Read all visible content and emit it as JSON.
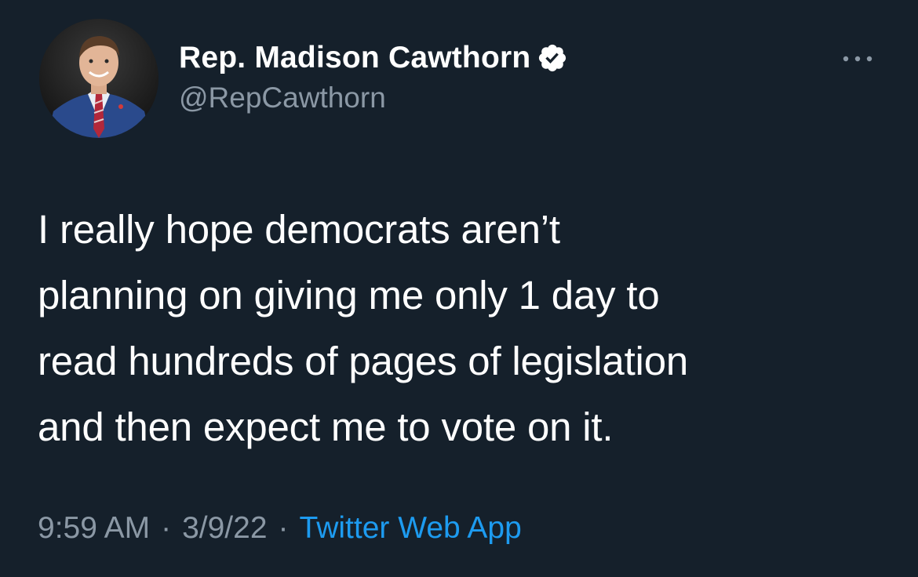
{
  "tweet": {
    "author": {
      "display_name": "Rep. Madison Cawthorn",
      "handle": "@RepCawthorn",
      "verified": true,
      "avatar_icon": "profile-photo"
    },
    "more_icon": "more-horizontal-icon",
    "text": "I really hope democrats aren’t\nplanning on giving me only 1 day to\nread hundreds of pages of legislation\nand then expect me to vote on it.",
    "time": "9:59 AM",
    "separator": "·",
    "date": "3/9/22",
    "source": "Twitter Web App"
  },
  "colors": {
    "background": "#15202b",
    "primary_text": "#ffffff",
    "secondary_text": "#8b98a5",
    "link": "#1d9bf0"
  }
}
